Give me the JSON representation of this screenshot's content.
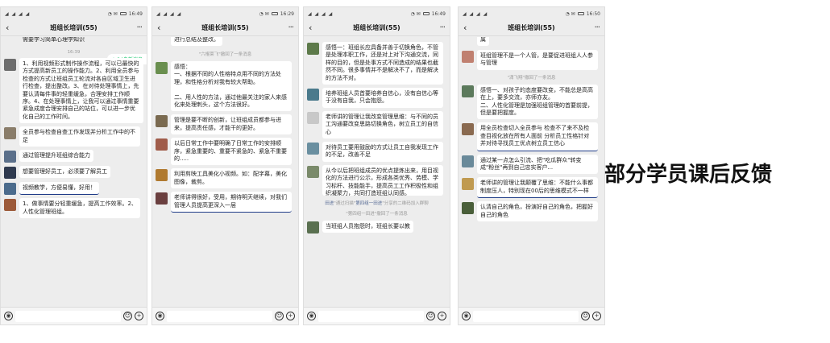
{
  "headline": "部分学员课后反馈",
  "phones": [
    {
      "status": {
        "signal": "◢ ◢ ◢ ◢",
        "icons": "◔ ✉",
        "time": "16:49"
      },
      "title": "班组长培训(55)",
      "back": "‹",
      "more": "···",
      "new_badge": "↑ 24条新消息",
      "top_fragment": "需要学习简单心理学知识",
      "timestamp": "16:39",
      "messages": [
        {
          "avatar": "#6d6d6d",
          "text": "1、利用视频形式制作操作流程，可以已最快的方式提高新员工的操作能力。2、利用全员参与检查的方式让班组员工轮流对各自区域卫生进行检查，提出整改。3、在对待处理事情上，先要认清每件事的轻重缓急，合理安排工作顺序。4、在处理事情上，让我可以通过事情重要紧急成度合理安排自己的站位，可以进一步优化自己的工作时间。"
        },
        {
          "avatar": "#8a7d6a",
          "text": "全员参与检查自查工作发现并分析工作中的不足"
        },
        {
          "avatar": "#5a6f8a",
          "text": "通过管理提升班组综合能力"
        },
        {
          "avatar": "#2f3a4f",
          "text": "想要管理好员工，必须要了解员工"
        },
        {
          "avatar": "#4b6b8c",
          "text": "视频教学，方便易懂，好用！"
        },
        {
          "avatar": "#9c5a3a",
          "text": "1、做事情要分轻重缓急，提高工作效率。2、人性化管理班组。"
        }
      ]
    },
    {
      "status": {
        "signal": "◢ ◢ ◢ ◢",
        "icons": "◔ ✉",
        "time": "16:29"
      },
      "title": "班组长培训(55)",
      "back": "‹",
      "more": "···",
      "top_fragment": "进行总结及整改。",
      "sys_recall": "\"六棍莱飞\"撤回了一条消息",
      "messages": [
        {
          "avatar": "#6a8f4f",
          "text": "感悟：\n一、根据不同的人性格特点用不同的方法处理，和性格分析对我有较大帮助。\n\n二、用人性的方法，通过他最关注的家人来感化来处理刺头，这个方法很好。"
        },
        {
          "avatar": "#7a6a50",
          "text": "管理是要不断的创新，让班组成员都参与进来，提高责任感，才能干的更好。"
        },
        {
          "avatar": "#a05c4a",
          "text": "以后日常工作中要明确了日常工作的安排顺序，紧急重要的、重要不紧急的、紧急不重要的....."
        },
        {
          "avatar": "#b07a30",
          "text": "利用剪映工具美化小视频。如：配字幕，美化图像，裁剪。"
        },
        {
          "avatar": "#6a3f3f",
          "text": "老师讲得很好，受用，期待明天继续，对我们管理人员提高更深入一层"
        }
      ]
    },
    {
      "status": {
        "signal": "◢ ◢ ◢ ◢",
        "icons": "◔ ✉",
        "time": "16:49"
      },
      "title": "班组长培训(55)",
      "back": "‹",
      "more": "···",
      "messages": [
        {
          "avatar": "#5d7a4a",
          "text": "感悟一：班组长应具备并善于切换角色，不管是处理本职工作，还是对上对下沟通交流，同样的目的，但是处事方式不同造成的结果也截然不同。很多事情并不是解决不了，而是解决的方法不对。"
        },
        {
          "avatar": "#4a7a8c",
          "text": "培养班组人员首要培养自信心，没有自信心等于没有自我，只会抱怨。"
        },
        {
          "avatar": "#c8c8c8",
          "text": "老师讲的管理让我改变管理思维：与不同的员工沟通要改变思路切换角色，树立员工的自信心"
        },
        {
          "avatar": "#6a8fa0",
          "text": "对待员工要用鼓励的方式让员工自我发现工作的不足，改善不足"
        },
        {
          "avatar": "#7a8a6a",
          "text": "从今以后把班组成员的优点提炼出来，用目视化的方法进行公示，形成各类优秀、劳模、学习标杆、技能能手，提高员工工作积极性和组织凝聚力，共同打造班组认同感。"
        }
      ],
      "sys_join_a": "田进",
      "sys_join_b": "\"通过扫描\"",
      "sys_join_c": "第四组一田进",
      "sys_join_d": "\"分享的二维码加入群聊",
      "sys_recall": "\"第四组一田进\"撤回了一条消息",
      "bottom_msg": {
        "avatar": "#5a7050",
        "text": "当班组人员抱怨时，班组长要以教"
      }
    },
    {
      "status": {
        "signal": "◢ ◢ ◢ ◢",
        "icons": "◔ ✉",
        "time": "16:50"
      },
      "title": "班组长培训(55)",
      "back": "‹",
      "more": "···",
      "top_fragment": "属",
      "sys_recall": "\"潇飞翔\"撤回了一条消息",
      "messages": [
        {
          "avatar": "#c08070",
          "text": "班组管理不是一个人管，是要促进班组人人参与管理"
        },
        {
          "avatar": "#5c7a5c",
          "text": "感悟一、对孩子的态度要改变，不能总是高高在上，要多交流，亦师亦友。\n二、人性化管理是加强班组管理的首要前提，但是要把握度。"
        },
        {
          "avatar": "#8a6a50",
          "text": "用全员检查切入全员参与  检查不了来不及检查目视化放在所有人面前    分析员工性格针对并对待寻找员工优点树立员工信心"
        },
        {
          "avatar": "#6a8a9a",
          "text": "通过某一点怎么引流、把\"吃瓜群众\"转变成\"粉丝\"再到自己忠实客户..."
        },
        {
          "avatar": "#c09a50",
          "text": "老师讲的管理让我颠覆了思维：不能什么事都制度压人，特别现在00后的思维模式不一样"
        },
        {
          "avatar": "#4a5f3a",
          "text": "认清自己的角色，扮演好自己的角色，把握好自己的角色"
        }
      ]
    }
  ]
}
